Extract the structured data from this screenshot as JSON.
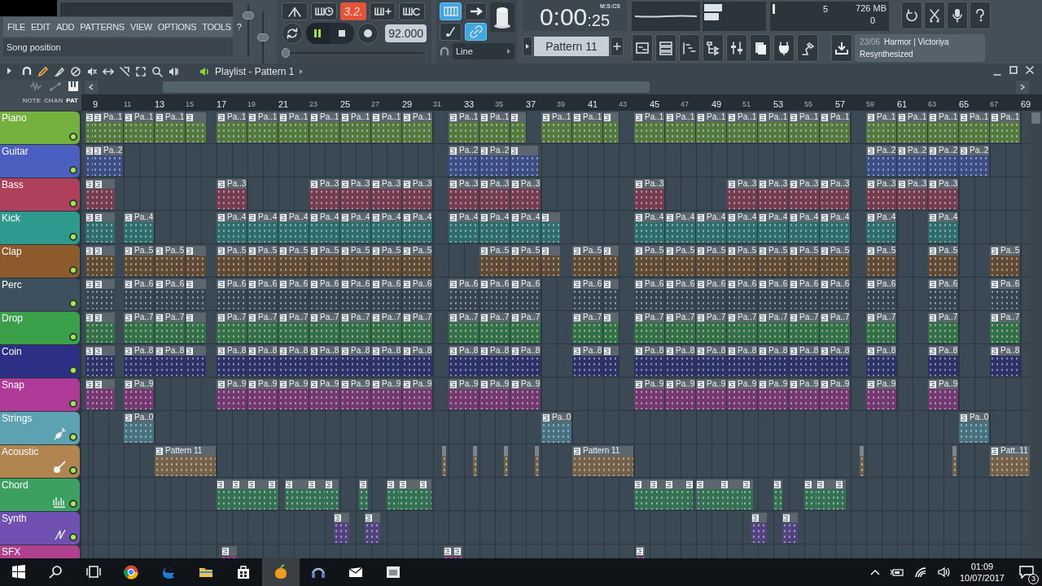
{
  "menu": [
    "FILE",
    "EDIT",
    "ADD",
    "PATTERNS",
    "VIEW",
    "OPTIONS",
    "TOOLS",
    "?"
  ],
  "hint": "Song position",
  "master_sliders": [
    {
      "level": 0.85
    },
    {
      "level": 0.5
    }
  ],
  "transport": {
    "countdown": "3.2.",
    "countdown_on": true,
    "playing": true,
    "tempo": "92.000",
    "song_position": {
      "level": 0
    }
  },
  "snap_buttons": [
    {
      "on": true
    },
    {
      "on": false
    },
    {
      "on": false
    },
    {
      "on": true
    }
  ],
  "snap": "Line",
  "time": {
    "main": "0:00",
    "fraction": ":25",
    "format": "M:S:CS"
  },
  "pattern": "Pattern 11",
  "meters": {
    "cpu": "5",
    "memory": "726 MB",
    "polyphony": "0"
  },
  "news": {
    "date": "23/06",
    "title": "Harmor | Victoriya",
    "subtitle": "Resynthesized"
  },
  "playlist": {
    "title": "Playlist - Pattern 1"
  },
  "filters": [
    {
      "label": "NOTE",
      "selected": false
    },
    {
      "label": "CHAN",
      "selected": false
    },
    {
      "label": "PAT",
      "selected": true
    }
  ],
  "ruler": [
    {
      "label": "9",
      "major": true
    },
    {
      "label": "11",
      "major": false
    },
    {
      "label": "13",
      "major": true
    },
    {
      "label": "15",
      "major": false
    },
    {
      "label": "17",
      "major": true
    },
    {
      "label": "19",
      "major": false
    },
    {
      "label": "21",
      "major": true
    },
    {
      "label": "23",
      "major": false
    },
    {
      "label": "25",
      "major": true
    },
    {
      "label": "27",
      "major": false
    },
    {
      "label": "29",
      "major": true
    },
    {
      "label": "31",
      "major": false
    },
    {
      "label": "33",
      "major": true
    },
    {
      "label": "35",
      "major": false
    },
    {
      "label": "37",
      "major": true
    },
    {
      "label": "39",
      "major": false
    },
    {
      "label": "41",
      "major": true
    },
    {
      "label": "43",
      "major": false
    },
    {
      "label": "45",
      "major": true
    },
    {
      "label": "47",
      "major": false
    },
    {
      "label": "49",
      "major": true
    },
    {
      "label": "51",
      "major": false
    },
    {
      "label": "53",
      "major": true
    },
    {
      "label": "55",
      "major": false
    },
    {
      "label": "57",
      "major": true
    },
    {
      "label": "59",
      "major": false
    },
    {
      "label": "61",
      "major": true
    },
    {
      "label": "63",
      "major": false
    },
    {
      "label": "65",
      "major": true
    },
    {
      "label": "67",
      "major": false
    },
    {
      "label": "69",
      "major": true
    }
  ],
  "tracks": [
    {
      "name": "Piano",
      "color": "#74b03e",
      "clips": [
        {
          "kind": "stub"
        },
        {
          "kind": "pattern",
          "label": "Pa..1"
        },
        {
          "kind": "pattern",
          "label": "Pa..1"
        },
        {
          "kind": "pattern",
          "label": "Pa..1"
        },
        {
          "kind": "stub"
        },
        {
          "kind": "pattern",
          "label": "Pa..1"
        },
        {
          "kind": "pattern",
          "label": "Pa..1"
        },
        {
          "kind": "pattern",
          "label": "Pa..1"
        },
        {
          "kind": "pattern",
          "label": "Pa..1"
        },
        {
          "kind": "pattern",
          "label": "Pa..1"
        },
        {
          "kind": "pattern",
          "label": "Pa..1"
        },
        {
          "kind": "pattern",
          "label": "Pa..1"
        },
        {
          "kind": "pattern",
          "label": "Pa..1"
        },
        {
          "kind": "pattern",
          "label": "Pa..1"
        },
        {
          "kind": "stub"
        },
        {
          "kind": "pattern",
          "label": "Pa..1"
        },
        {
          "kind": "pattern",
          "label": "Pa..1"
        },
        {
          "kind": "stub"
        },
        {
          "kind": "pattern",
          "label": "Pa..1"
        },
        {
          "kind": "pattern",
          "label": "Pa..1"
        },
        {
          "kind": "pattern",
          "label": "Pa..1"
        },
        {
          "kind": "pattern",
          "label": "Pa..1"
        },
        {
          "kind": "pattern",
          "label": "Pa..1"
        },
        {
          "kind": "pattern",
          "label": "Pa..1"
        },
        {
          "kind": "pattern",
          "label": "Pa..1"
        },
        {
          "kind": "pattern",
          "label": "Pa..1"
        },
        {
          "kind": "pattern",
          "label": "Pa..1"
        },
        {
          "kind": "pattern",
          "label": "Pa..1"
        },
        {
          "kind": "pattern",
          "label": "Pa..1"
        },
        {
          "kind": "pattern",
          "label": "Pa..1"
        }
      ]
    },
    {
      "name": "Guitar",
      "color": "#4a5fc0",
      "clips": [
        {
          "kind": "stub"
        },
        {
          "kind": "pattern",
          "label": "Pa..2"
        },
        {
          "kind": "pattern",
          "label": "Pa..2"
        },
        {
          "kind": "pattern",
          "label": "Pa..2"
        },
        {
          "kind": "stub"
        },
        {
          "kind": "pattern",
          "label": "Pa..2"
        },
        {
          "kind": "pattern",
          "label": "Pa..2"
        },
        {
          "kind": "pattern",
          "label": "Pa..2"
        },
        {
          "kind": "pattern",
          "label": "Pa..2"
        }
      ]
    },
    {
      "name": "Bass",
      "color": "#ae405c",
      "clips": [
        {
          "kind": "stub"
        },
        {
          "kind": "stub"
        },
        {
          "kind": "pattern",
          "label": "Pa..3"
        },
        {
          "kind": "pattern",
          "label": "Pa..3"
        },
        {
          "kind": "pattern",
          "label": "Pa..3"
        },
        {
          "kind": "pattern",
          "label": "Pa..3"
        },
        {
          "kind": "pattern",
          "label": "Pa..3"
        },
        {
          "kind": "pattern",
          "label": "Pa..3"
        },
        {
          "kind": "pattern",
          "label": "Pa..3"
        },
        {
          "kind": "pattern",
          "label": "Pa..3"
        },
        {
          "kind": "pattern",
          "label": "Pa..3"
        },
        {
          "kind": "pattern",
          "label": "Pa..3"
        },
        {
          "kind": "pattern",
          "label": "Pa..3"
        },
        {
          "kind": "pattern",
          "label": "Pa..3"
        },
        {
          "kind": "pattern",
          "label": "Pa..3"
        },
        {
          "kind": "pattern",
          "label": "Pa..3"
        },
        {
          "kind": "pattern",
          "label": "Pa..3"
        },
        {
          "kind": "pattern",
          "label": "Pa..3"
        }
      ]
    },
    {
      "name": "Kick",
      "color": "#2e9a8e",
      "clips": [
        {
          "kind": "stub"
        },
        {
          "kind": "stub"
        },
        {
          "kind": "pattern",
          "label": "Pa..4"
        },
        {
          "kind": "pattern",
          "label": "Pa..4"
        },
        {
          "kind": "pattern",
          "label": "Pa..4"
        },
        {
          "kind": "pattern",
          "label": "Pa..4"
        },
        {
          "kind": "pattern",
          "label": "Pa..4"
        },
        {
          "kind": "pattern",
          "label": "Pa..4"
        },
        {
          "kind": "pattern",
          "label": "Pa..4"
        },
        {
          "kind": "pattern",
          "label": "Pa..4"
        },
        {
          "kind": "pattern",
          "label": "Pa..4"
        },
        {
          "kind": "pattern",
          "label": "Pa..4"
        },
        {
          "kind": "pattern",
          "label": "Pa..4"
        },
        {
          "kind": "stub"
        },
        {
          "kind": "pattern",
          "label": "Pa..4"
        },
        {
          "kind": "pattern",
          "label": "Pa..4"
        },
        {
          "kind": "pattern",
          "label": "Pa..4"
        },
        {
          "kind": "pattern",
          "label": "Pa..4"
        },
        {
          "kind": "pattern",
          "label": "Pa..4"
        },
        {
          "kind": "pattern",
          "label": "Pa..4"
        },
        {
          "kind": "pattern",
          "label": "Pa..4"
        },
        {
          "kind": "pattern",
          "label": "Pa..4"
        },
        {
          "kind": "pattern",
          "label": "Pa..4"
        }
      ]
    },
    {
      "name": "Clap",
      "color": "#8c5a2b",
      "clips": [
        {
          "kind": "stub"
        },
        {
          "kind": "stub"
        },
        {
          "kind": "pattern",
          "label": "Pa..5"
        },
        {
          "kind": "pattern",
          "label": "Pa..5"
        },
        {
          "kind": "stub"
        },
        {
          "kind": "pattern",
          "label": "Pa..5"
        },
        {
          "kind": "pattern",
          "label": "Pa..5"
        },
        {
          "kind": "pattern",
          "label": "Pa..5"
        },
        {
          "kind": "pattern",
          "label": "Pa..5"
        },
        {
          "kind": "pattern",
          "label": "Pa..5"
        },
        {
          "kind": "pattern",
          "label": "Pa..5"
        },
        {
          "kind": "pattern",
          "label": "Pa..5"
        },
        {
          "kind": "pattern",
          "label": "Pa..5"
        },
        {
          "kind": "pattern",
          "label": "Pa..5"
        },
        {
          "kind": "stub"
        },
        {
          "kind": "pattern",
          "label": "Pa..5"
        },
        {
          "kind": "stub"
        },
        {
          "kind": "pattern",
          "label": "Pa..5"
        },
        {
          "kind": "pattern",
          "label": "Pa..5"
        },
        {
          "kind": "pattern",
          "label": "Pa..5"
        },
        {
          "kind": "pattern",
          "label": "Pa..5"
        },
        {
          "kind": "pattern",
          "label": "Pa..5"
        },
        {
          "kind": "pattern",
          "label": "Pa..5"
        },
        {
          "kind": "pattern",
          "label": "Pa..5"
        },
        {
          "kind": "pattern",
          "label": "Pa..5"
        },
        {
          "kind": "pattern",
          "label": "Pa..5"
        },
        {
          "kind": "pattern",
          "label": "Pa..5"
        }
      ]
    },
    {
      "name": "Perc",
      "color": "#3e505e",
      "clips": [
        {
          "kind": "stub"
        },
        {
          "kind": "stub"
        },
        {
          "kind": "pattern",
          "label": "Pa..6"
        },
        {
          "kind": "pattern",
          "label": "Pa..6"
        },
        {
          "kind": "stub"
        },
        {
          "kind": "pattern",
          "label": "Pa..6"
        },
        {
          "kind": "pattern",
          "label": "Pa..6"
        },
        {
          "kind": "pattern",
          "label": "Pa..6"
        },
        {
          "kind": "pattern",
          "label": "Pa..6"
        },
        {
          "kind": "pattern",
          "label": "Pa..6"
        },
        {
          "kind": "pattern",
          "label": "Pa..6"
        },
        {
          "kind": "pattern",
          "label": "Pa..6"
        },
        {
          "kind": "pattern",
          "label": "Pa..6"
        },
        {
          "kind": "pattern",
          "label": "Pa..6"
        },
        {
          "kind": "pattern",
          "label": "Pa..6"
        },
        {
          "kind": "pattern",
          "label": "Pa..6"
        },
        {
          "kind": "stub"
        },
        {
          "kind": "pattern",
          "label": "Pa..6"
        },
        {
          "kind": "pattern",
          "label": "Pa..6"
        },
        {
          "kind": "pattern",
          "label": "Pa..6"
        },
        {
          "kind": "pattern",
          "label": "Pa..6"
        },
        {
          "kind": "pattern",
          "label": "Pa..6"
        },
        {
          "kind": "pattern",
          "label": "Pa..6"
        },
        {
          "kind": "pattern",
          "label": "Pa..6"
        },
        {
          "kind": "pattern",
          "label": "Pa..6"
        },
        {
          "kind": "pattern",
          "label": "Pa..6"
        },
        {
          "kind": "pattern",
          "label": "Pa..6"
        }
      ]
    },
    {
      "name": "Drop",
      "color": "#3ba04a",
      "clips": [
        {
          "kind": "stub"
        },
        {
          "kind": "stub"
        },
        {
          "kind": "pattern",
          "label": "Pa..7"
        },
        {
          "kind": "pattern",
          "label": "Pa..7"
        },
        {
          "kind": "stub"
        },
        {
          "kind": "pattern",
          "label": "Pa..7"
        },
        {
          "kind": "pattern",
          "label": "Pa..7"
        },
        {
          "kind": "pattern",
          "label": "Pa..7"
        },
        {
          "kind": "pattern",
          "label": "Pa..7"
        },
        {
          "kind": "pattern",
          "label": "Pa..7"
        },
        {
          "kind": "pattern",
          "label": "Pa..7"
        },
        {
          "kind": "pattern",
          "label": "Pa..7"
        },
        {
          "kind": "pattern",
          "label": "Pa..7"
        },
        {
          "kind": "pattern",
          "label": "Pa..7"
        },
        {
          "kind": "pattern",
          "label": "Pa..7"
        },
        {
          "kind": "pattern",
          "label": "Pa..7"
        },
        {
          "kind": "stub"
        },
        {
          "kind": "pattern",
          "label": "Pa..7"
        },
        {
          "kind": "pattern",
          "label": "Pa..7"
        },
        {
          "kind": "pattern",
          "label": "Pa..7"
        },
        {
          "kind": "pattern",
          "label": "Pa..7"
        },
        {
          "kind": "pattern",
          "label": "Pa..7"
        },
        {
          "kind": "pattern",
          "label": "Pa..7"
        },
        {
          "kind": "pattern",
          "label": "Pa..7"
        },
        {
          "kind": "pattern",
          "label": "Pa..7"
        },
        {
          "kind": "pattern",
          "label": "Pa..7"
        },
        {
          "kind": "pattern",
          "label": "Pa..7"
        }
      ]
    },
    {
      "name": "Coin",
      "color": "#2c2f84",
      "clips": [
        {
          "kind": "stub"
        },
        {
          "kind": "stub"
        },
        {
          "kind": "pattern",
          "label": "Pa..8"
        },
        {
          "kind": "pattern",
          "label": "Pa..8"
        },
        {
          "kind": "stub"
        },
        {
          "kind": "pattern",
          "label": "Pa..8"
        },
        {
          "kind": "pattern",
          "label": "Pa..8"
        },
        {
          "kind": "pattern",
          "label": "Pa..8"
        },
        {
          "kind": "pattern",
          "label": "Pa..8"
        },
        {
          "kind": "pattern",
          "label": "Pa..8"
        },
        {
          "kind": "pattern",
          "label": "Pa..8"
        },
        {
          "kind": "pattern",
          "label": "Pa..8"
        },
        {
          "kind": "pattern",
          "label": "Pa..8"
        },
        {
          "kind": "pattern",
          "label": "Pa..8"
        },
        {
          "kind": "pattern",
          "label": "Pa..8"
        },
        {
          "kind": "pattern",
          "label": "Pa..8"
        },
        {
          "kind": "stub"
        },
        {
          "kind": "pattern",
          "label": "Pa..8"
        },
        {
          "kind": "pattern",
          "label": "Pa..8"
        },
        {
          "kind": "pattern",
          "label": "Pa..8"
        },
        {
          "kind": "pattern",
          "label": "Pa..8"
        },
        {
          "kind": "pattern",
          "label": "Pa..8"
        },
        {
          "kind": "pattern",
          "label": "Pa..8"
        },
        {
          "kind": "pattern",
          "label": "Pa..8"
        },
        {
          "kind": "pattern",
          "label": "Pa..8"
        },
        {
          "kind": "pattern",
          "label": "Pa..8"
        },
        {
          "kind": "pattern",
          "label": "Pa..8"
        }
      ]
    },
    {
      "name": "Snap",
      "color": "#b03a98",
      "clips": [
        {
          "kind": "stub"
        },
        {
          "kind": "stub"
        },
        {
          "kind": "pattern",
          "label": "Pa..9"
        },
        {
          "kind": "pattern",
          "label": "Pa..9"
        },
        {
          "kind": "pattern",
          "label": "Pa..9"
        },
        {
          "kind": "pattern",
          "label": "Pa..9"
        },
        {
          "kind": "pattern",
          "label": "Pa..9"
        },
        {
          "kind": "pattern",
          "label": "Pa..9"
        },
        {
          "kind": "pattern",
          "label": "Pa..9"
        },
        {
          "kind": "pattern",
          "label": "Pa..9"
        },
        {
          "kind": "pattern",
          "label": "Pa..9"
        },
        {
          "kind": "pattern",
          "label": "Pa..9"
        },
        {
          "kind": "pattern",
          "label": "Pa..9"
        },
        {
          "kind": "pattern",
          "label": "Pa..9"
        },
        {
          "kind": "pattern",
          "label": "Pa..9"
        },
        {
          "kind": "pattern",
          "label": "Pa..9"
        },
        {
          "kind": "pattern",
          "label": "Pa..9"
        },
        {
          "kind": "pattern",
          "label": "Pa..9"
        },
        {
          "kind": "pattern",
          "label": "Pa..9"
        },
        {
          "kind": "pattern",
          "label": "Pa..9"
        },
        {
          "kind": "pattern",
          "label": "Pa..9"
        },
        {
          "kind": "pattern",
          "label": "Pa..9"
        }
      ]
    },
    {
      "name": "Strings",
      "color": "#5ca2b2",
      "clips": [
        {
          "kind": "pattern",
          "label": "Pa..0"
        },
        {
          "kind": "pattern",
          "label": "Pa..0"
        },
        {
          "kind": "pattern",
          "label": "Pa..0"
        }
      ]
    },
    {
      "name": "Acoustic",
      "color": "#b08550",
      "clips": [
        {
          "kind": "pattern",
          "label": "Pattern 11"
        },
        {
          "kind": "sliver"
        },
        {
          "kind": "sliver"
        },
        {
          "kind": "sliver"
        },
        {
          "kind": "sliver"
        },
        {
          "kind": "pattern",
          "label": "Pattern 11"
        },
        {
          "kind": "sliver"
        },
        {
          "kind": "sliver"
        },
        {
          "kind": "pattern",
          "label": "Patt..11"
        }
      ]
    },
    {
      "name": "Chord",
      "color": "#3ba060",
      "clips": [
        {
          "kind": "stub"
        },
        {
          "kind": "stub"
        },
        {
          "kind": "stub"
        },
        {
          "kind": "stub"
        },
        {
          "kind": "stub"
        },
        {
          "kind": "stub"
        },
        {
          "kind": "stub"
        },
        {
          "kind": "stub"
        },
        {
          "kind": "stub"
        },
        {
          "kind": "stub"
        },
        {
          "kind": "stub"
        },
        {
          "kind": "stub"
        },
        {
          "kind": "stub"
        },
        {
          "kind": "stub"
        },
        {
          "kind": "stub"
        },
        {
          "kind": "stub"
        },
        {
          "kind": "stub"
        },
        {
          "kind": "stub"
        },
        {
          "kind": "stub"
        },
        {
          "kind": "stub"
        },
        {
          "kind": "stub"
        },
        {
          "kind": "stub"
        }
      ]
    },
    {
      "name": "Synth",
      "color": "#7050b0",
      "clips": [
        {
          "kind": "stub"
        },
        {
          "kind": "stub"
        },
        {
          "kind": "stub"
        },
        {
          "kind": "stub"
        }
      ]
    },
    {
      "name": "SFX",
      "color": "#b04090",
      "clips": [
        {
          "kind": "stub"
        },
        {
          "kind": "stub"
        },
        {
          "kind": "stub"
        },
        {
          "kind": "stub"
        }
      ]
    }
  ],
  "taskbar": {
    "time": "01:09",
    "date": "10/07/2017",
    "notifications": "3"
  }
}
